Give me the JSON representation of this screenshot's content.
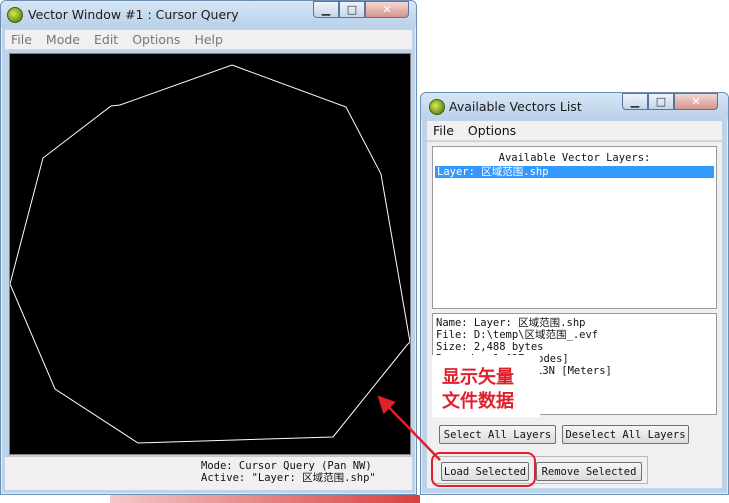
{
  "vector_window": {
    "title": "Vector Window #1 : Cursor Query",
    "menu": [
      "File",
      "Mode",
      "Edit",
      "Options",
      "Help"
    ],
    "status_mode": "Mode: Cursor Query (Pan NW)",
    "status_active": "Active: \"Layer: 区域范围.shp\""
  },
  "available_window": {
    "title": "Available Vectors List",
    "menu": [
      "File",
      "Options"
    ],
    "list_heading": "Available Vector Layers:",
    "layers": [
      "Layer: 区域范围.shp"
    ],
    "info_lines": [
      "Name: Layer: 区域范围.shp",
      "File: D:\\temp\\区域范围_.evf",
      "Size: 2,488 bytes",
      "Records: 1 [37 nodes]",
      "13N [Meters]"
    ],
    "buttons": {
      "select_all": "Select All Layers",
      "deselect_all": "Deselect All Layers",
      "load_selected": "Load Selected",
      "remove_selected": "Remove Selected"
    }
  },
  "annotation": {
    "text_line1": "显示矢量",
    "text_line2": "文件数据",
    "color": "#e0202a"
  },
  "window_controls": {
    "minimize": "▁",
    "maximize": "□",
    "close": "✕"
  }
}
